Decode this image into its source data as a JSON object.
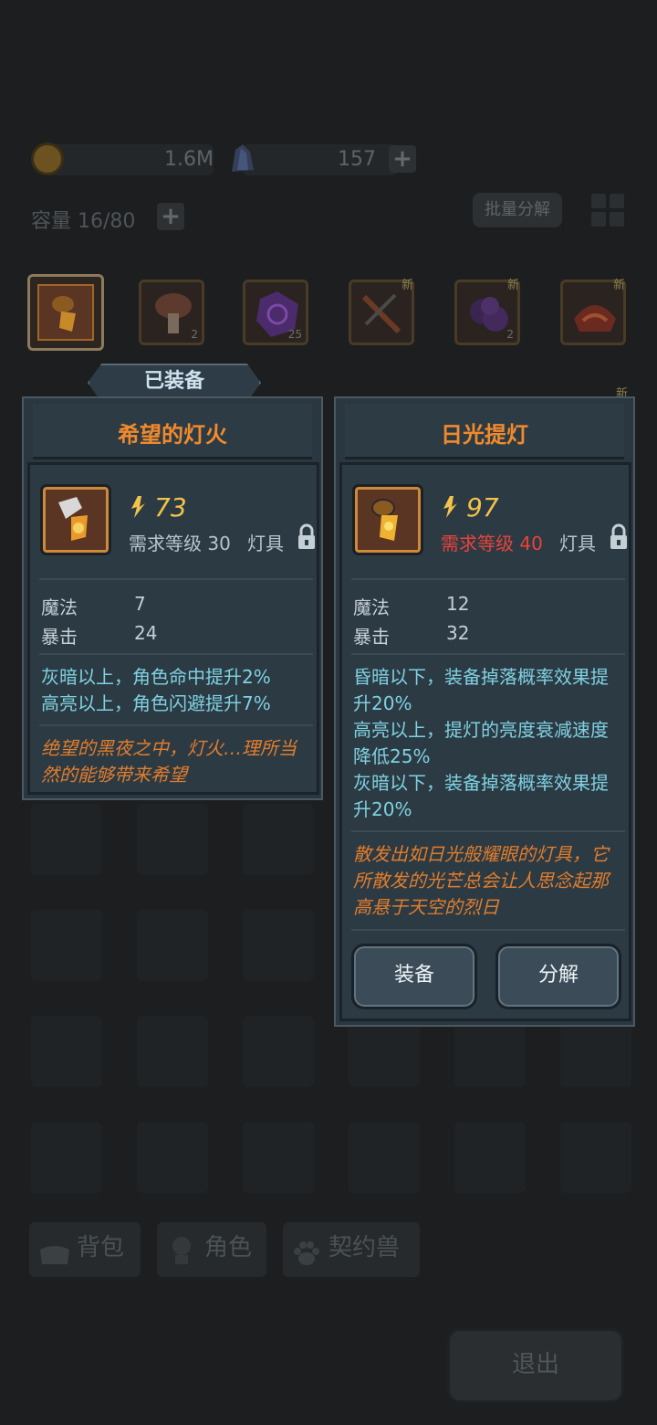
{
  "resources": {
    "gold": "1.6M",
    "crystal": "157"
  },
  "capacity": {
    "label": "容量 16/80"
  },
  "bulk_decompose_label": "批量分解",
  "inventory": [
    {
      "icon": "lamp-icon",
      "count": "",
      "new": ""
    },
    {
      "icon": "mushroom-icon",
      "count": "2",
      "new": ""
    },
    {
      "icon": "purple-gem-icon",
      "count": "25",
      "new": ""
    },
    {
      "icon": "crossbow-icon",
      "count": "",
      "new": "新"
    },
    {
      "icon": "purple-ore-icon",
      "count": "2",
      "new": "新"
    },
    {
      "icon": "red-helmet-icon",
      "count": "",
      "new": "新"
    },
    {
      "icon": "hidden-item",
      "count": "",
      "new": "新"
    }
  ],
  "equipped_tag": "已装备",
  "equipped_item": {
    "name": "希望的灯火",
    "power": "73",
    "requirement": "需求等级 30",
    "type": "灯具",
    "stats": [
      {
        "label": "魔法",
        "value": "7"
      },
      {
        "label": "暴击",
        "value": "24"
      }
    ],
    "effects": [
      "灰暗以上，角色命中提升2%",
      "高亮以上，角色闪避提升7%"
    ],
    "lore": "绝望的黑夜之中，灯火…理所当然的能够带来希望"
  },
  "selected_item": {
    "name": "日光提灯",
    "power": "97",
    "requirement": "需求等级 40",
    "type": "灯具",
    "stats": [
      {
        "label": "魔法",
        "value": "12"
      },
      {
        "label": "暴击",
        "value": "32"
      }
    ],
    "effects": [
      "昏暗以下，装备掉落概率效果提升20%",
      "高亮以上，提灯的亮度衰减速度降低25%",
      "灰暗以下，装备掉落概率效果提升20%"
    ],
    "lore": "散发出如日光般耀眼的灯具，它所散发的光芒总会让人思念起那高悬于天空的烈日",
    "equip_label": "装备",
    "decompose_label": "分解"
  },
  "tabs": [
    {
      "label": "背包",
      "icon": "bag-icon"
    },
    {
      "label": "角色",
      "icon": "character-icon"
    },
    {
      "label": "契约兽",
      "icon": "paw-icon"
    }
  ],
  "exit_label": "退出",
  "colors": {
    "title_orange": "#f08a2c",
    "power_gold": "#f2c34a",
    "effect_cyan": "#7fd1e0",
    "requirement_red": "#e8433a"
  }
}
